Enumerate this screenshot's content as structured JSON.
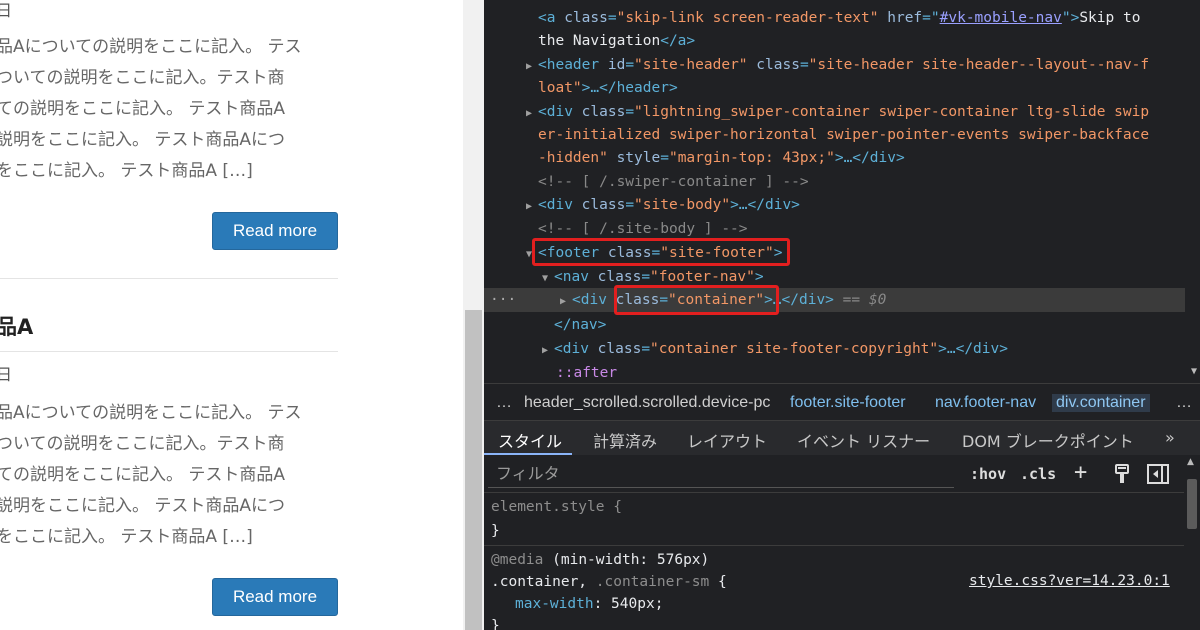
{
  "page": {
    "posts": [
      {
        "date": "日",
        "excerpt_lines": [
          "品Aについての説明をここに記入。 テス",
          "ついての説明をここに記入。テスト商",
          "ての説明をここに記入。 テスト商品A",
          "説明をここに記入。 テスト商品Aにつ",
          "をここに記入。 テスト商品A […]"
        ],
        "read_more": "Read more"
      },
      {
        "title": "品A",
        "date": "日",
        "excerpt_lines": [
          "品Aについての説明をここに記入。 テス",
          "ついての説明をここに記入。テスト商",
          "ての説明をここに記入。 テスト商品A",
          "説明をここに記入。 テスト商品Aにつ",
          "をここに記入。 テスト商品A […]"
        ],
        "read_more": "Read more"
      }
    ]
  },
  "devtools": {
    "elements": {
      "skip_link_text": "Skip to",
      "skip_link_cont": "the Navigation",
      "skip_link_href": "#vk-mobile-nav",
      "header_class_1": "\"site-header site-header--layout--nav-f",
      "header_class_2": "loat\"",
      "swiper_class_1": "\"lightning_swiper-container swiper-container ltg-slide swip",
      "swiper_class_2": "er-initialized swiper-horizontal swiper-pointer-events swiper-backface",
      "swiper_class_3": "-hidden\"",
      "swiper_style": "\"margin-top: 43px;\"",
      "comment_swiper": "<!-- [ /.swiper-container ] -->",
      "site_body_class": "\"site-body\"",
      "comment_site_body": "<!-- [ /.site-body ] -->",
      "footer_class": "\"site-footer\"",
      "footer_nav_class": "\"footer-nav\"",
      "container_class": "\"container\"",
      "selected_marker": "== $0",
      "copyright_class": "\"container site-footer-copyright\"",
      "after_pseudo": "::after",
      "row_dots": "···"
    },
    "breadcrumbs": {
      "more": "…",
      "items": [
        "header_scrolled.scrolled.device-pc",
        "footer.site-footer",
        "nav.footer-nav",
        "div.container"
      ],
      "overflow": "…"
    },
    "tabs": [
      "スタイル",
      "計算済み",
      "レイアウト",
      "イベント リスナー",
      "DOM ブレークポイント"
    ],
    "tabs_more": "»",
    "filter": {
      "placeholder": "フィルタ",
      "hov": ":hov",
      "cls": ".cls",
      "plus": "+"
    },
    "styles": {
      "element_style": "element.style {",
      "close_brace": "}",
      "media_kw": "@media",
      "media_query": "(min-width: 576px)",
      "selector_main": ".container,",
      "selector_dim": ".container-sm",
      "open_brace": "{",
      "prop_name": "max-width",
      "prop_value": "540px;",
      "source": "style.css?ver=14.23.0:1"
    }
  }
}
